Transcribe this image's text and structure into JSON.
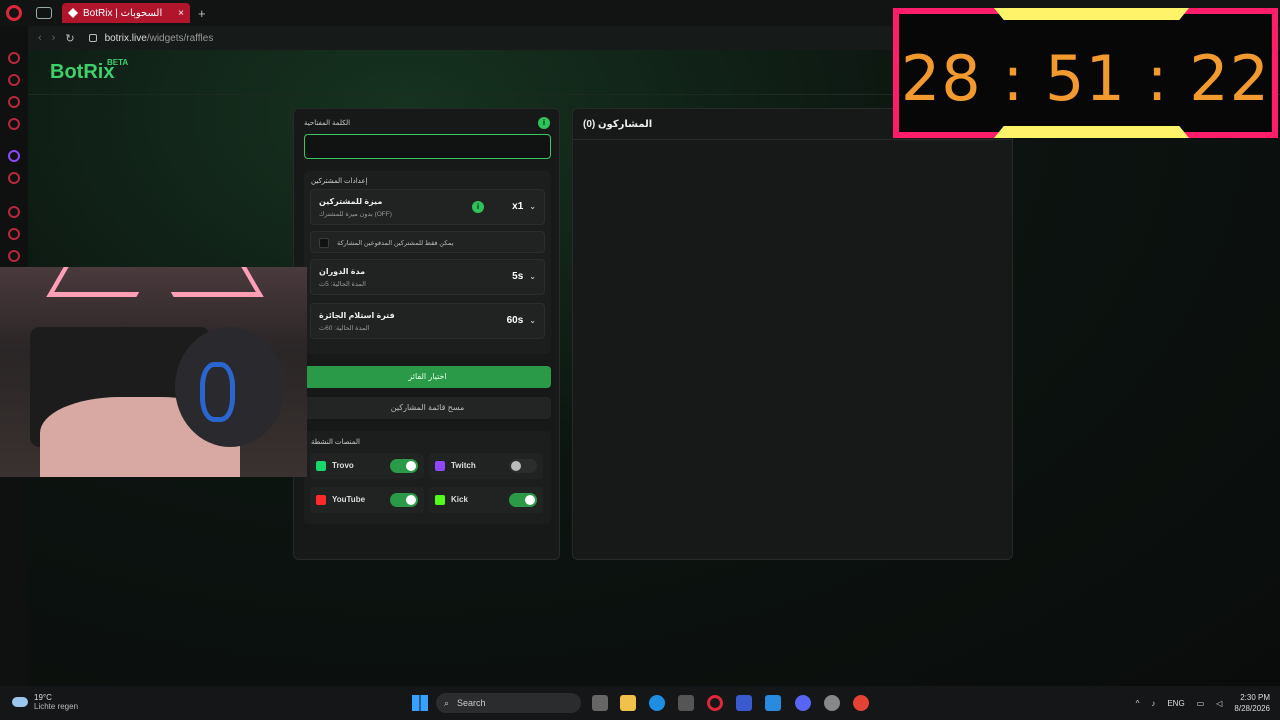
{
  "browser": {
    "tab_title": "BotRix | السحوبات",
    "url_host": "botrix.live",
    "url_path": "/widgets/raffles",
    "new_tab": "+",
    "tab_close": "×"
  },
  "header": {
    "logo": "BotRix",
    "beta": "BETA"
  },
  "raffle": {
    "keyword_label": "الكلمة المفتاحية",
    "keyword_value": "",
    "settings_title": "إعدادات المشتركين",
    "subscriber_bonus": {
      "title": "ميزة للمشتركين",
      "sub": "بدون ميزة للمشترك (OFF)",
      "value": "x1"
    },
    "subs_only_label": "يمكن فقط للمشتركين المدفوعين المشاركة",
    "spin_duration": {
      "title": "مدة الدوران",
      "sub": "المدة الحالية: 5ث",
      "value": "5s"
    },
    "claim_period": {
      "title": "فترة استلام الجائزة",
      "sub": "المدة الحالية: 60ث",
      "value": "60s"
    },
    "pick_winner": "اختيار الفائز",
    "clear_list": "مسح قائمة المشاركين",
    "platforms_title": "المنصات النشطة",
    "platforms": [
      {
        "name": "Trovo",
        "enabled": true,
        "color": "#19d66b"
      },
      {
        "name": "Twitch",
        "enabled": false,
        "color": "#9146ff"
      },
      {
        "name": "YouTube",
        "enabled": true,
        "color": "#ff2a2a"
      },
      {
        "name": "Kick",
        "enabled": true,
        "color": "#53fc18"
      }
    ]
  },
  "participants": {
    "title": "المشاركون (0)"
  },
  "timer": {
    "text": "28 : 51 : 22"
  },
  "taskbar": {
    "temp": "19°C",
    "weather": "Lichte regen",
    "search": "Search",
    "lang": "ENG",
    "time": "2:30 PM",
    "date": "8/28/2026"
  },
  "colors": {
    "accent": "#2a9a48",
    "timer_border": "#ff1c6a",
    "timer_text": "#f39a2e"
  }
}
